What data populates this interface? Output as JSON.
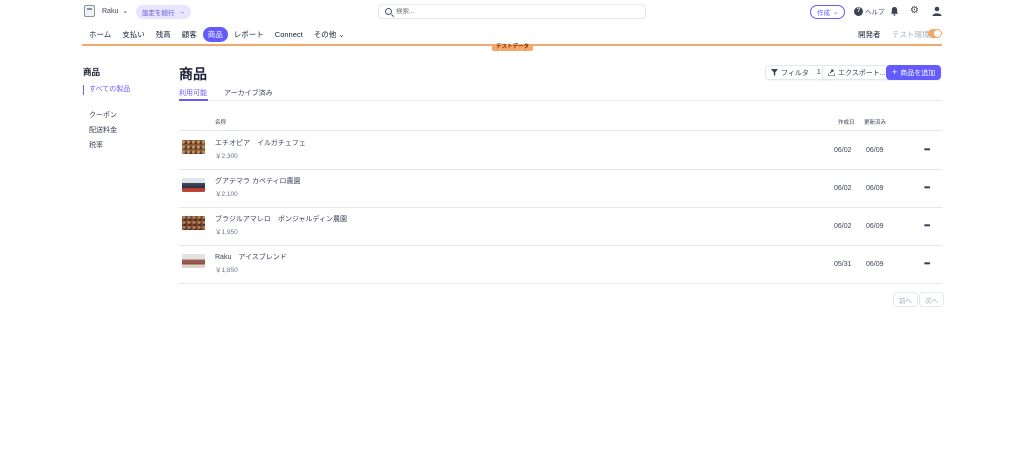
{
  "topbar": {
    "account_name": "Raku",
    "setup_label": "設定を続行",
    "search_placeholder": "検索...",
    "create_label": "作成",
    "help_label": "ヘルプ"
  },
  "nav": {
    "items": [
      {
        "label": "ホーム"
      },
      {
        "label": "支払い"
      },
      {
        "label": "残高"
      },
      {
        "label": "顧客"
      },
      {
        "label": "商品"
      },
      {
        "label": "レポート"
      },
      {
        "label": "Connect"
      },
      {
        "label": "その他"
      }
    ],
    "active_index": 4,
    "developer_label": "開発者",
    "test_mode_label": "テスト環境",
    "test_data_badge": "テストデータ"
  },
  "sidebar": {
    "title": "商品",
    "items": [
      {
        "label": "すべての製品",
        "active": true
      },
      {
        "label": "クーポン"
      },
      {
        "label": "配送料金"
      },
      {
        "label": "税率"
      }
    ]
  },
  "main": {
    "title": "商品",
    "tabs": [
      {
        "label": "利用可能",
        "active": true
      },
      {
        "label": "アーカイブ済み"
      }
    ],
    "buttons": {
      "filter_label": "フィルタ",
      "filter_count": "1",
      "export_label": "エクスポート...",
      "add_label": "商品を追加"
    },
    "table": {
      "headers": {
        "name": "名称",
        "created": "作成日",
        "updated": "更新済み"
      },
      "rows": [
        {
          "name": "エチオピア　イルガチェフェ",
          "price": "￥2,300",
          "created": "06/02",
          "updated": "06/09",
          "thumb_color": "#8a5a3a"
        },
        {
          "name": "グアテマラ カペティロ農園",
          "price": "￥2,100",
          "created": "06/02",
          "updated": "06/09",
          "thumb_color": "#3e4a5c"
        },
        {
          "name": "ブラジルアマレロ　ボンジャルディン農園",
          "price": "￥1,950",
          "created": "06/02",
          "updated": "06/09",
          "thumb_color": "#7a4a30"
        },
        {
          "name": "Raku　アイスブレンド",
          "price": "￥1,850",
          "created": "05/31",
          "updated": "06/09",
          "thumb_color": "#8c6a5c"
        }
      ]
    },
    "pager": {
      "prev_label": "前へ",
      "next_label": "次へ"
    }
  },
  "colors": {
    "accent": "#635bff",
    "test_mode": "#f5a86b"
  }
}
